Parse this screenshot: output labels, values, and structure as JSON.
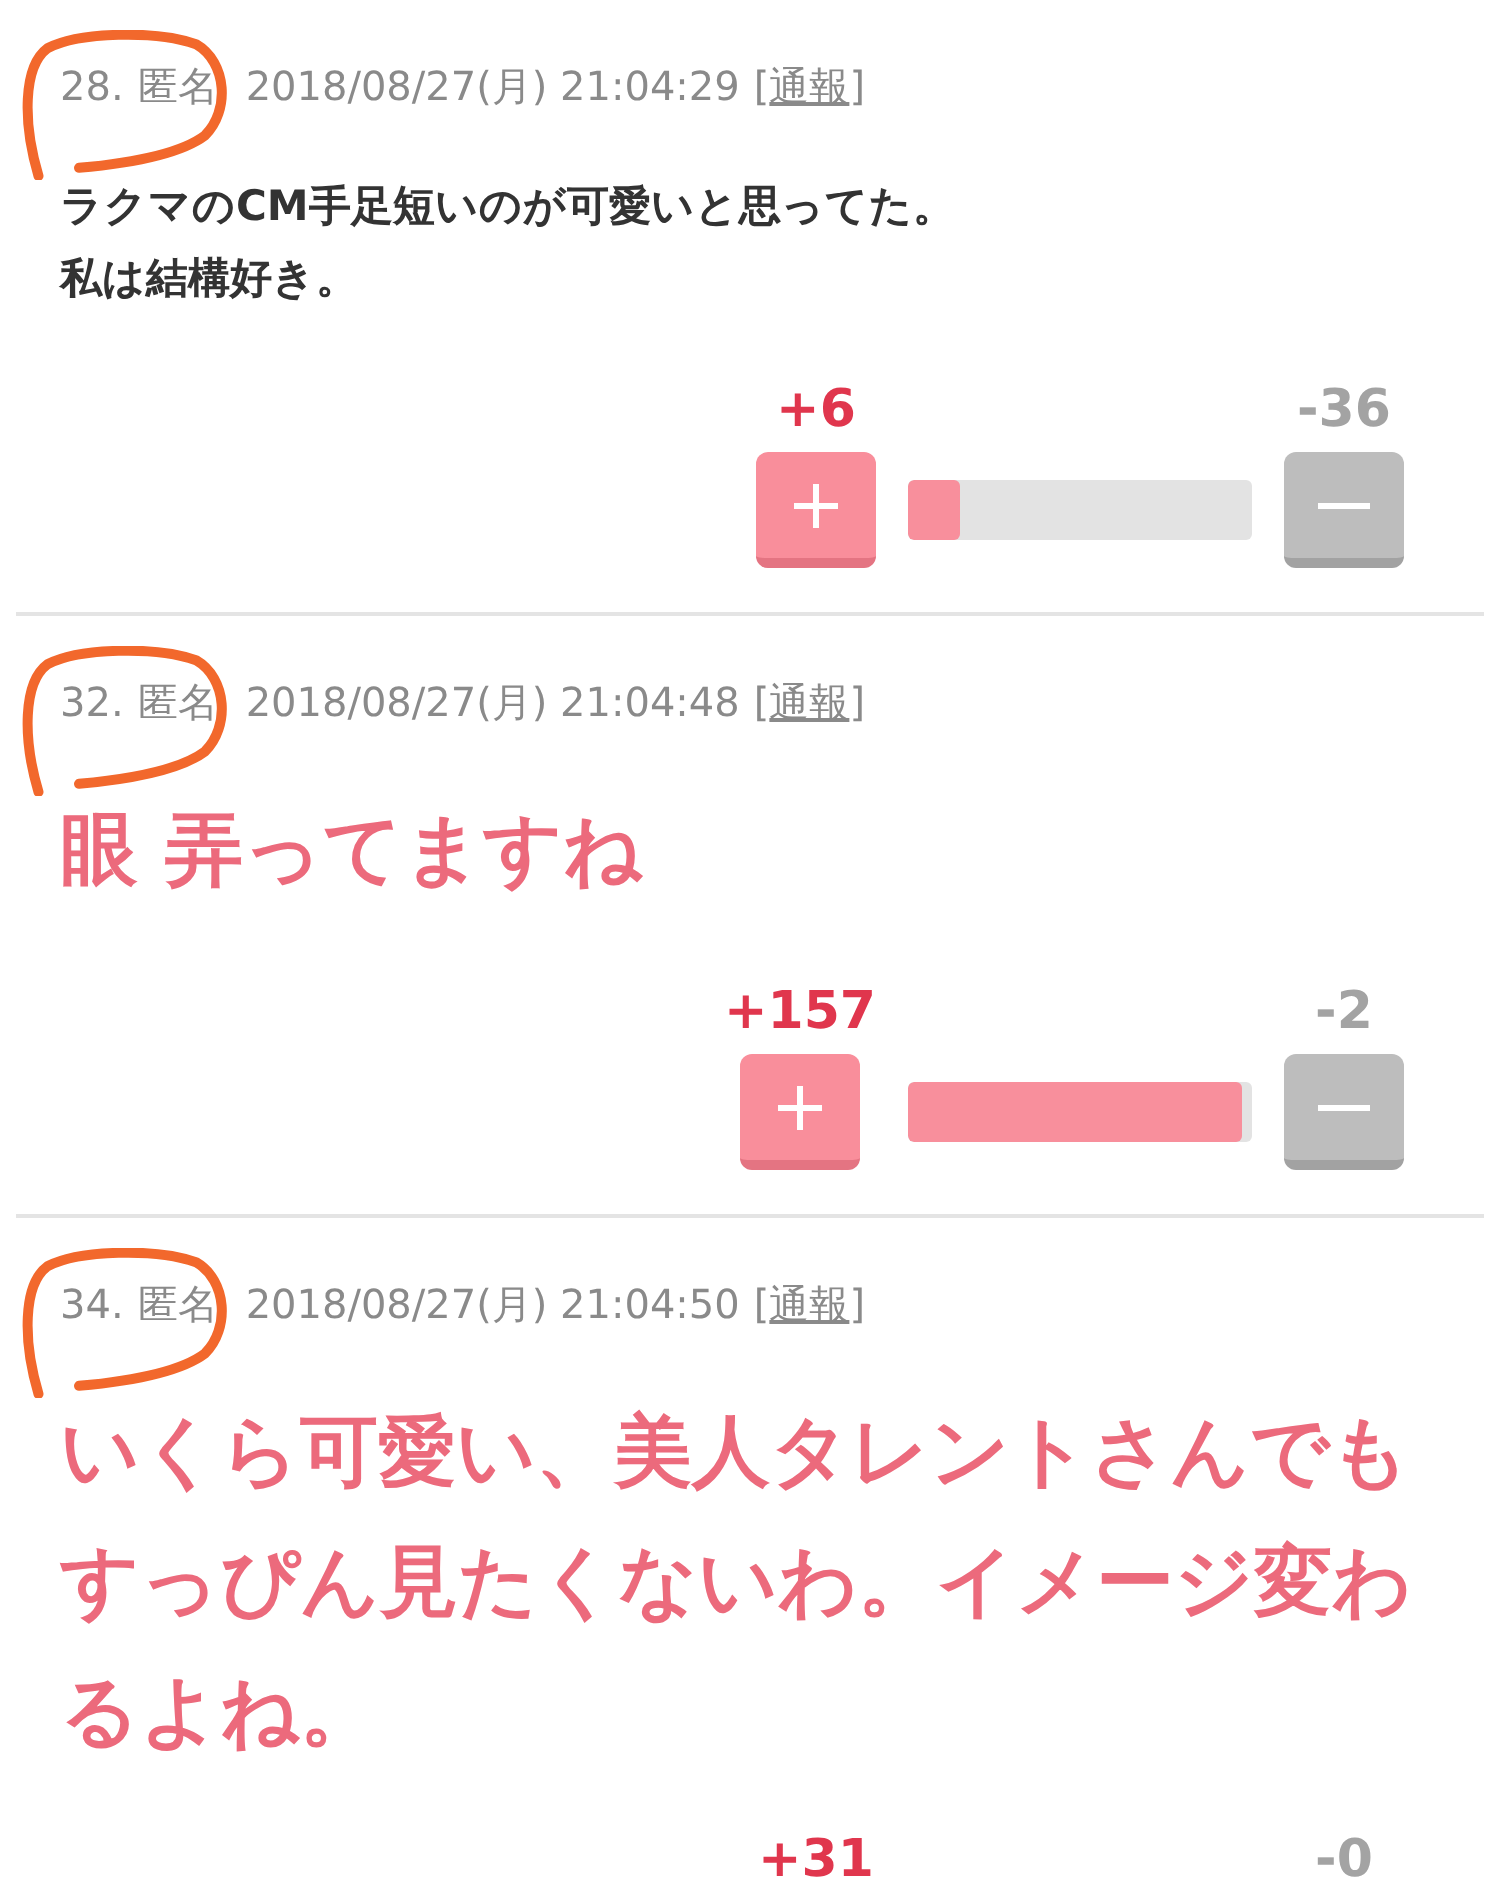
{
  "comments": [
    {
      "number": "28.",
      "name": "匿名",
      "date": "2018/08/27(月) 21:04:29",
      "report_brackets": [
        "[",
        "]"
      ],
      "report_link": "通報",
      "circled": true,
      "kind": "plain",
      "lines": [
        "ラクマのCM手足短いのが可愛いと思ってた。",
        "私は結構好き。"
      ],
      "vote": {
        "plus": "+6",
        "minus": "-36",
        "level": 0.15
      }
    },
    {
      "number": "32.",
      "name": "匿名",
      "date": "2018/08/27(月) 21:04:48",
      "report_brackets": [
        "[",
        "]"
      ],
      "report_link": "通報",
      "circled": true,
      "kind": "large",
      "lines": [
        "眼 弄ってますね"
      ],
      "vote": {
        "plus": "+157",
        "minus": "-2",
        "level": 0.97
      }
    },
    {
      "number": "34.",
      "name": "匿名",
      "date": "2018/08/27(月) 21:04:50",
      "report_brackets": [
        "[",
        "]"
      ],
      "report_link": "通報",
      "circled": true,
      "kind": "large",
      "lines": [
        "いくら可愛い、美人タレントさんでもすっぴん見たくないわ。イメージ変わるよね。"
      ],
      "vote": {
        "plus": "+31",
        "minus": "-0"
      }
    }
  ]
}
